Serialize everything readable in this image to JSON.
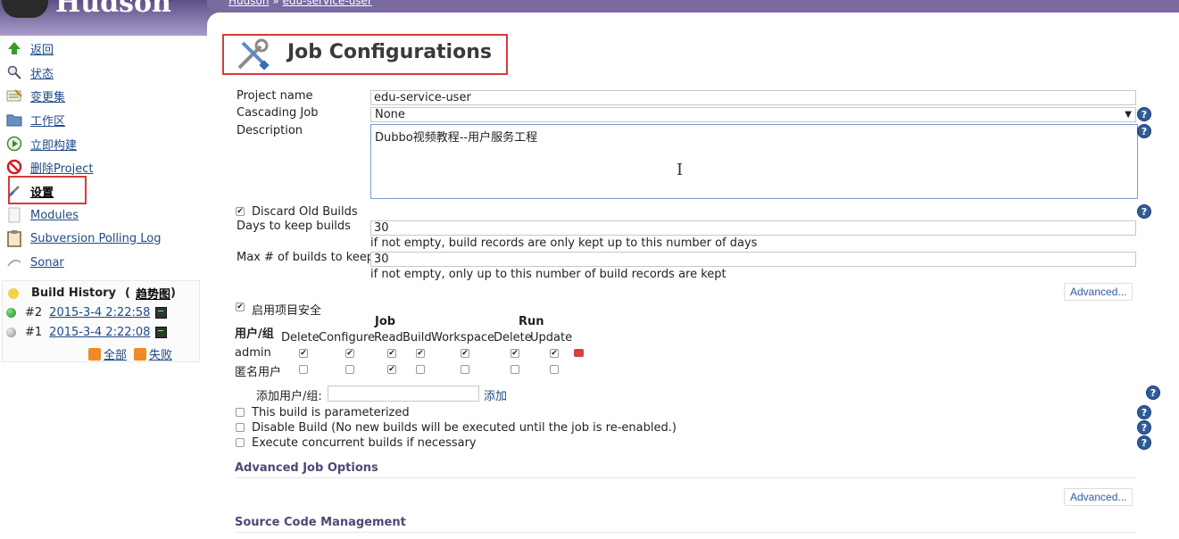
{
  "header": {
    "logo_text": "Hudson",
    "breadcrumb": {
      "root": "Hudson",
      "sep": "»",
      "job": "edu-service-user"
    }
  },
  "sidebar": {
    "items": [
      {
        "label": "返回",
        "icon": "arrow-up-icon"
      },
      {
        "label": "状态",
        "icon": "magnifier-icon"
      },
      {
        "label": "变更集",
        "icon": "notepad-icon"
      },
      {
        "label": "工作区",
        "icon": "folder-icon"
      },
      {
        "label": "立即构建",
        "icon": "build-clock-icon"
      },
      {
        "label": "删除Project",
        "icon": "no-entry-icon"
      },
      {
        "label": "设置",
        "icon": "wrench-icon"
      },
      {
        "label": "Modules",
        "icon": "document-icon"
      },
      {
        "label": "Subversion Polling Log",
        "icon": "clipboard-icon"
      },
      {
        "label": "Sonar",
        "icon": "sonar-icon"
      }
    ],
    "build_history": {
      "title": "Build History",
      "trend_label": "趋势图",
      "builds": [
        {
          "number": "#2",
          "date": "2015-3-4 2:22:58",
          "status_color": "#2a8a2a"
        },
        {
          "number": "#1",
          "date": "2015-3-4 2:22:08",
          "status_color": "#9a9a9a"
        }
      ],
      "feed_all": "全部",
      "feed_failed": "失败"
    }
  },
  "main": {
    "title": "Job Configurations",
    "project_name_label": "Project name",
    "project_name_value": "edu-service-user",
    "cascading_label": "Cascading Job",
    "cascading_value": "None",
    "description_label": "Description",
    "description_value": "Dubbo视频教程--用户服务工程",
    "discard_old_label": "Discard Old Builds",
    "days_keep_label": "Days to keep builds",
    "days_keep_value": "30",
    "days_keep_hint": "if not empty, build records are only kept up to this number of days",
    "max_builds_label": "Max # of builds to keep",
    "max_builds_value": "30",
    "max_builds_hint": "if not empty, only up to this number of build records are kept",
    "advanced_label": "Advanced...",
    "project_security_label": "启用项目安全",
    "matrix": {
      "user_group_header": "用户/组",
      "group_job": "Job",
      "group_run": "Run",
      "columns": [
        "Delete",
        "Configure",
        "Read",
        "Build",
        "Workspace",
        "Delete",
        "Update"
      ],
      "rows": [
        {
          "name": "admin",
          "checks": [
            true,
            true,
            true,
            true,
            true,
            true,
            true
          ]
        },
        {
          "name": "匿名用户",
          "checks": [
            false,
            false,
            true,
            false,
            false,
            false,
            false
          ]
        }
      ]
    },
    "add_user_label": "添加用户/组:",
    "add_user_placeholder": "",
    "add_button": "添加",
    "parameterized_label": "This build is parameterized",
    "disable_label": "Disable Build (No new builds will be executed until the job is re-enabled.)",
    "concurrent_label": "Execute concurrent builds if necessary",
    "advanced_job_options": "Advanced Job Options",
    "advanced_label_2": "Advanced...",
    "scm_heading": "Source Code Management"
  }
}
